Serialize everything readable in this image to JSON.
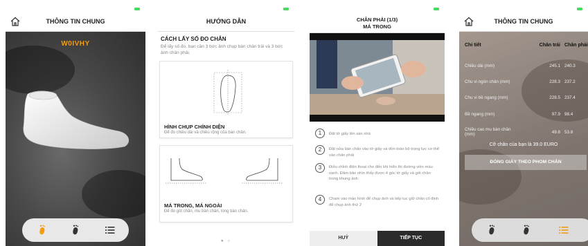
{
  "screen1": {
    "title": "THÔNG TIN CHUNG",
    "code": "W0IVHY"
  },
  "screen2": {
    "title": "HƯỚNG DẪN",
    "heading": "CÁCH LẤY SỐ ĐO CHÂN",
    "description": "Để lấy số đo, bạn cần 3 bức ảnh chụp bàn chân trái và 3 bức ảnh chân phải.",
    "cards": [
      {
        "title": "HÌNH CHỤP CHÍNH DIỆN",
        "desc": "Để đo chiều dài và chiều rộng của bàn chân."
      },
      {
        "title": "MÁ TRONG, MÁ NGOÀI",
        "desc": "Để đo gót chân, mu bàn chân, lòng bàn chân."
      }
    ],
    "pager": "● ○"
  },
  "screen3": {
    "title_line1": "CHÂN PHẢI (1/3)",
    "title_line2": "MÁ TRONG",
    "steps": [
      {
        "num": "1",
        "text": "Đặt tờ giấy lên sàn nhà"
      },
      {
        "num": "2",
        "text": "Đặt nửa bàn chân vào tờ giấy và dồn toàn bộ trọng lực cơ thể vào chân phải"
      },
      {
        "num": "3",
        "text": "Điều chỉnh điện thoại cho đến khi hiển thị đường viền màu xanh. Đảm bảo nhìn thấy được 4 góc tờ giấy và gót chân trong khung ảnh"
      },
      {
        "num": "4",
        "text": "Chạm vào màn hình để chụp ảnh và tiếp tục giữ chân cố định để chụp ảnh thứ 2"
      }
    ],
    "cancel_label": "HUỶ",
    "next_label": "TIẾP TỤC"
  },
  "screen4": {
    "title": "THÔNG TIN CHUNG",
    "table": {
      "headers": [
        "Chi tiết",
        "Chân trái",
        "Chân phải"
      ],
      "rows": [
        {
          "label": "Chiều dài (mm)",
          "left": "245.1",
          "right": "240.3"
        },
        {
          "label": "Chu vi ngón chân (mm)",
          "left": "228.3",
          "right": "237.2"
        },
        {
          "label": "Chu vi bề ngang (mm)",
          "left": "228.5",
          "right": "237.4"
        },
        {
          "label": "Bề ngang (mm)",
          "left": "97.9",
          "right": "98.4"
        },
        {
          "label": "Chiều cao mu bàn chân (mm)",
          "left": "49.8",
          "right": "53.8"
        }
      ]
    },
    "note": "Cỡ chân của bạn là 39.0 EURO",
    "order_button": "ĐÓNG GIÀY THEO PHOM CHÂN"
  },
  "colors": {
    "accent": "#f39c12",
    "dark_button": "#2b2b2b",
    "battery": "#4cd964"
  }
}
